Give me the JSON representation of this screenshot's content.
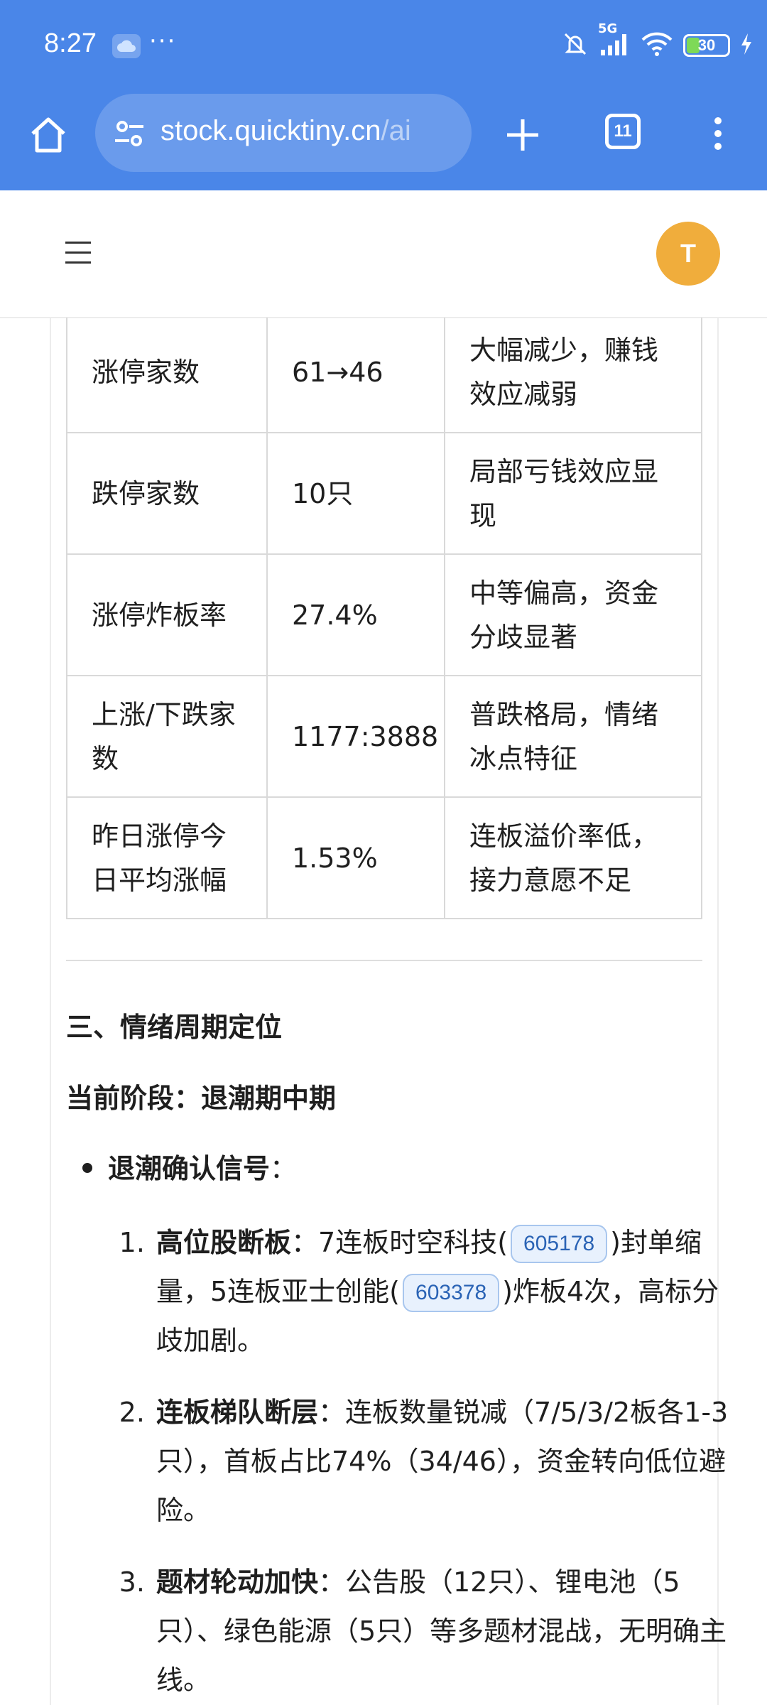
{
  "status_bar": {
    "time": "8:27",
    "notification_dots": "···",
    "network": "5G",
    "battery_level": "30"
  },
  "browser": {
    "url_host": "stock.quicktiny.cn",
    "url_path": "/ai",
    "tab_count": "11"
  },
  "header": {
    "avatar_letter": "T"
  },
  "metrics_table": {
    "rows": [
      {
        "metric": "涨停家数",
        "value": "61→46",
        "note": "大幅减少，赚钱效应减弱"
      },
      {
        "metric": "跌停家数",
        "value": "10只",
        "note": "局部亏钱效应显现"
      },
      {
        "metric": "涨停炸板率",
        "value": "27.4%",
        "note": "中等偏高，资金分歧显著"
      },
      {
        "metric": "上涨/下跌家数",
        "value": "1177:3888",
        "note": "普跌格局，情绪冰点特征"
      },
      {
        "metric": "昨日涨停今日平均涨幅",
        "value": "1.53%",
        "note": "连板溢价率低，接力意愿不足"
      }
    ]
  },
  "section": {
    "heading": "三、情绪周期定位",
    "stage_label": "当前阶段：退潮期中期",
    "bullet_title": "退潮确认信号",
    "bullet_colon": "："
  },
  "signals": [
    {
      "title": "高位股断板",
      "colon": "：",
      "t1": "7连板时空科技(",
      "code1": "605178",
      "t2": ")封单缩量，5连板亚士创能(",
      "code2": "603378",
      "t3": ")炸板4次，高标分歧加剧。"
    },
    {
      "title": "连板梯队断层",
      "colon": "：",
      "text": "连板数量锐减（7/5/3/2板各1-3只），首板占比74%（34/46），资金转向低位避险。"
    },
    {
      "title": "题材轮动加快",
      "colon": "：",
      "text": "公告股（12只）、锂电池（5只）、绿色能源（5只）等多题材混战，无明确主线。"
    }
  ],
  "colors": {
    "toolbar_bg": "#4a86e8",
    "avatar_bg": "#f0ad3c",
    "code_chip_bg": "#e8f1fd",
    "code_chip_text": "#2a63b5"
  }
}
